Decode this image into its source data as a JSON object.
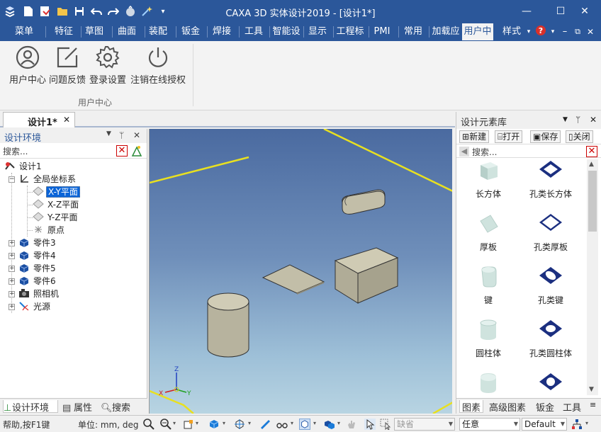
{
  "app": {
    "title": "CAXA 3D 实体设计2019 - [设计1*]"
  },
  "window_controls": {
    "minimize": "—",
    "maximize": "☐",
    "close": "✕"
  },
  "menu": {
    "items": [
      "菜单",
      "特征",
      "草图",
      "曲面",
      "装配",
      "钣金",
      "焊接",
      "工具",
      "智能设",
      "显示",
      "工程标",
      "PMI",
      "常用",
      "加载应",
      "用户中",
      "样式"
    ],
    "active_index": 14,
    "style_caret": "▾"
  },
  "ribbon": {
    "buttons": [
      {
        "label": "用户中心",
        "icon": "user-circle-icon"
      },
      {
        "label": "问题反馈",
        "icon": "edit-feedback-icon"
      },
      {
        "label": "登录设置",
        "icon": "settings-gear-icon"
      },
      {
        "label": "注销在线授权",
        "icon": "power-icon"
      }
    ],
    "group_label": "用户中心"
  },
  "document": {
    "tab_label": "设计1*",
    "tab_close": "✕"
  },
  "left_panel": {
    "title": "设计环境",
    "search_placeholder": "搜索...",
    "tree": [
      {
        "label": "设计1",
        "icon": "design-root-icon"
      },
      {
        "label": "全局坐标系",
        "icon": "coordinate-system-icon"
      },
      {
        "label": "X-Y平面",
        "icon": "plane-icon",
        "selected": true
      },
      {
        "label": "X-Z平面",
        "icon": "plane-icon"
      },
      {
        "label": "Y-Z平面",
        "icon": "plane-icon"
      },
      {
        "label": "原点",
        "icon": "origin-icon"
      },
      {
        "label": "零件3",
        "icon": "part-icon"
      },
      {
        "label": "零件4",
        "icon": "part-icon"
      },
      {
        "label": "零件5",
        "icon": "part-icon"
      },
      {
        "label": "零件6",
        "icon": "part-icon"
      },
      {
        "label": "照相机",
        "icon": "camera-icon"
      },
      {
        "label": "光源",
        "icon": "light-icon"
      }
    ],
    "bottom_tabs": [
      "设计环境",
      "属性",
      "搜索"
    ]
  },
  "viewport": {
    "axes": {
      "x": "X",
      "y": "Y",
      "z": "Z"
    }
  },
  "right_panel": {
    "title": "设计元素库",
    "toolbar": [
      "新建",
      "打开",
      "保存",
      "关闭"
    ],
    "search_placeholder": "搜索...",
    "items": [
      {
        "label": "长方体",
        "icon": "box-icon"
      },
      {
        "label": "孔类长方体",
        "icon": "hole-box-icon"
      },
      {
        "label": "厚板",
        "icon": "thick-plate-icon"
      },
      {
        "label": "孔类厚板",
        "icon": "hole-plate-icon"
      },
      {
        "label": "键",
        "icon": "key-icon"
      },
      {
        "label": "孔类键",
        "icon": "hole-key-icon"
      },
      {
        "label": "圆柱体",
        "icon": "cylinder-icon"
      },
      {
        "label": "孔类圆柱体",
        "icon": "hole-cylinder-icon"
      },
      {
        "label": "",
        "icon": "rounded-block-icon"
      },
      {
        "label": "",
        "icon": "hole-rounded-icon"
      }
    ],
    "bottom_tabs": [
      "图素",
      "高级图素",
      "钣金",
      "工具"
    ]
  },
  "status_bar": {
    "help_text": "帮助,按F1键",
    "units_text": "单位: mm, deg",
    "default_combo": "缺省",
    "any_combo": "任意",
    "default_combo2": "Default"
  },
  "colors": {
    "title_blue": "#2b579a",
    "selection_blue": "#0a64d8",
    "grid_yellow": "#e8e020"
  }
}
